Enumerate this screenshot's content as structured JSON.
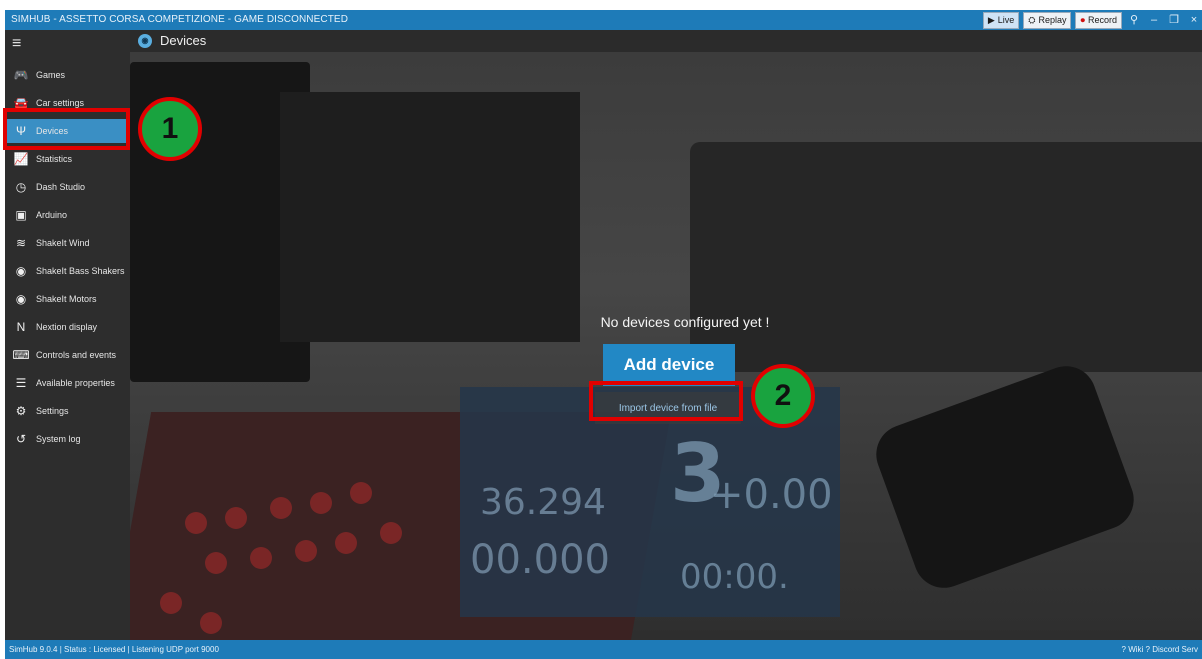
{
  "window": {
    "title": "SIMHUB - ASSETTO CORSA COMPETIZIONE - GAME DISCONNECTED",
    "buttons": {
      "live": "Live",
      "replay": "Replay",
      "record": "Record"
    }
  },
  "sidebar": {
    "items": [
      {
        "label": "Games",
        "icon": "gamepad-icon"
      },
      {
        "label": "Car settings",
        "icon": "car-icon"
      },
      {
        "label": "Devices",
        "icon": "usb-icon"
      },
      {
        "label": "Statistics",
        "icon": "chart-icon"
      },
      {
        "label": "Dash Studio",
        "icon": "gauge-icon"
      },
      {
        "label": "Arduino",
        "icon": "board-icon"
      },
      {
        "label": "ShakeIt Wind",
        "icon": "wind-icon"
      },
      {
        "label": "ShakeIt Bass Shakers",
        "icon": "speaker-icon"
      },
      {
        "label": "ShakeIt Motors",
        "icon": "motor-icon"
      },
      {
        "label": "Nextion display",
        "icon": "nextion-icon"
      },
      {
        "label": "Controls and events",
        "icon": "keyboard-icon"
      },
      {
        "label": "Available properties",
        "icon": "list-icon"
      },
      {
        "label": "Settings",
        "icon": "gear-icon"
      },
      {
        "label": "System log",
        "icon": "history-icon"
      }
    ]
  },
  "main": {
    "title": "Devices",
    "empty_message": "No devices configured yet !",
    "add_button": "Add device",
    "import_link": "Import device from file",
    "background_readouts": [
      "36.294",
      "00.000",
      "+0.00",
      "3",
      "00:00."
    ]
  },
  "status": {
    "left": "SimHub 9.0.4 | Status : Licensed | Listening UDP port 9000",
    "right": "? Wiki  ? Discord Serv"
  },
  "annotations": {
    "badge1": "1",
    "badge2": "2"
  },
  "colors": {
    "accent": "#1e7bb8",
    "highlight": "#e10000",
    "badge": "#19a33f"
  }
}
